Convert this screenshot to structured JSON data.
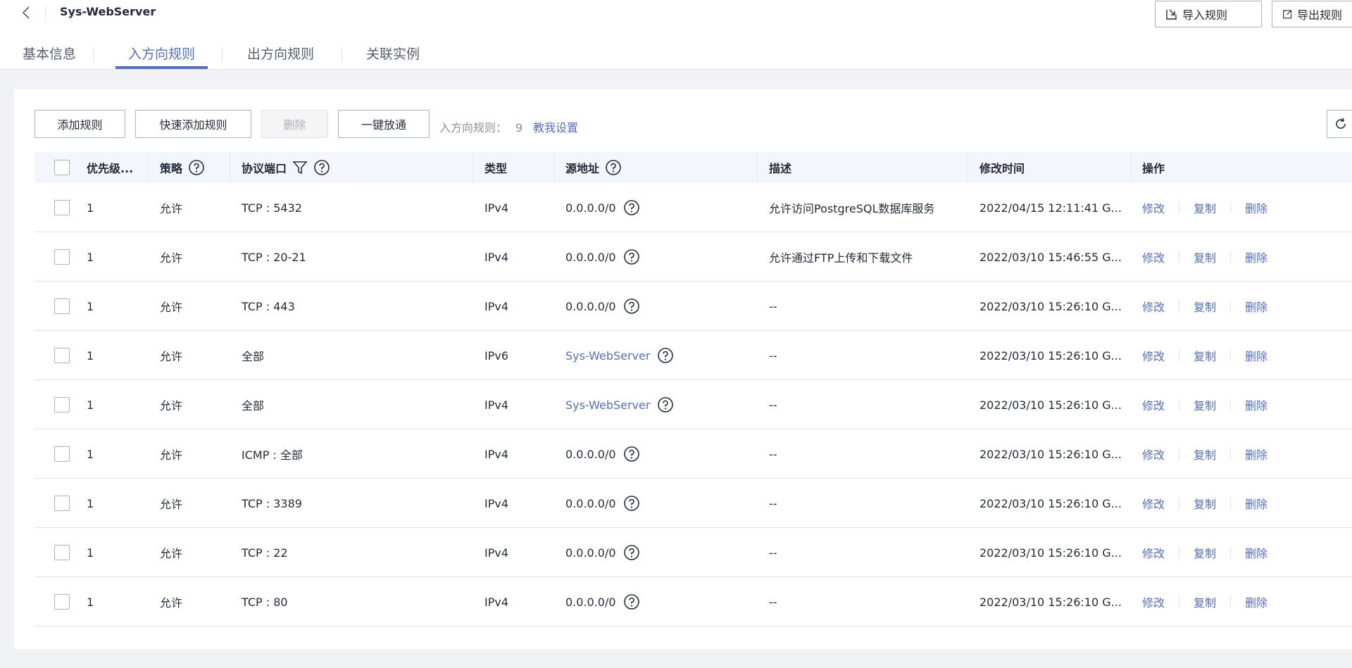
{
  "header": {
    "title": "Sys-WebServer",
    "import_label": "导入规则",
    "export_label": "导出规则"
  },
  "tabs": [
    {
      "label": "基本信息"
    },
    {
      "label": "入方向规则"
    },
    {
      "label": "出方向规则"
    },
    {
      "label": "关联实例"
    }
  ],
  "toolbar": {
    "add_rule": "添加规则",
    "quick_add": "快速添加规则",
    "delete": "删除",
    "one_click": "一键放通",
    "count_label": "入方向规则：",
    "count_value": "9",
    "teach_link": "教我设置"
  },
  "columns": {
    "priority": "优先级...",
    "policy": "策略",
    "protocol_port": "协议端口",
    "type": "类型",
    "source": "源地址",
    "description": "描述",
    "modified": "修改时间",
    "operation": "操作"
  },
  "row_actions": {
    "edit": "修改",
    "copy": "复制",
    "delete": "删除"
  },
  "rows": [
    {
      "priority": "1",
      "policy": "允许",
      "protocol": "TCP : 5432",
      "type": "IPv4",
      "source": "0.0.0.0/0",
      "desc": "允许访问PostgreSQL数据库服务",
      "time": "2022/04/15 12:11:41 G..."
    },
    {
      "priority": "1",
      "policy": "允许",
      "protocol": "TCP : 20-21",
      "type": "IPv4",
      "source": "0.0.0.0/0",
      "desc": "允许通过FTP上传和下载文件",
      "time": "2022/03/10 15:46:55 G..."
    },
    {
      "priority": "1",
      "policy": "允许",
      "protocol": "TCP : 443",
      "type": "IPv4",
      "source": "0.0.0.0/0",
      "desc": "--",
      "time": "2022/03/10 15:26:10 G..."
    },
    {
      "priority": "1",
      "policy": "允许",
      "protocol": "全部",
      "type": "IPv6",
      "source": "Sys-WebServer",
      "desc": "--",
      "time": "2022/03/10 15:26:10 G..."
    },
    {
      "priority": "1",
      "policy": "允许",
      "protocol": "全部",
      "type": "IPv4",
      "source": "Sys-WebServer",
      "desc": "--",
      "time": "2022/03/10 15:26:10 G..."
    },
    {
      "priority": "1",
      "policy": "允许",
      "protocol": "ICMP : 全部",
      "type": "IPv4",
      "source": "0.0.0.0/0",
      "desc": "--",
      "time": "2022/03/10 15:26:10 G..."
    },
    {
      "priority": "1",
      "policy": "允许",
      "protocol": "TCP : 3389",
      "type": "IPv4",
      "source": "0.0.0.0/0",
      "desc": "--",
      "time": "2022/03/10 15:26:10 G..."
    },
    {
      "priority": "1",
      "policy": "允许",
      "protocol": "TCP : 22",
      "type": "IPv4",
      "source": "0.0.0.0/0",
      "desc": "--",
      "time": "2022/03/10 15:26:10 G..."
    },
    {
      "priority": "1",
      "policy": "允许",
      "protocol": "TCP : 80",
      "type": "IPv4",
      "source": "0.0.0.0/0",
      "desc": "--",
      "time": "2022/03/10 15:26:10 G..."
    }
  ]
}
